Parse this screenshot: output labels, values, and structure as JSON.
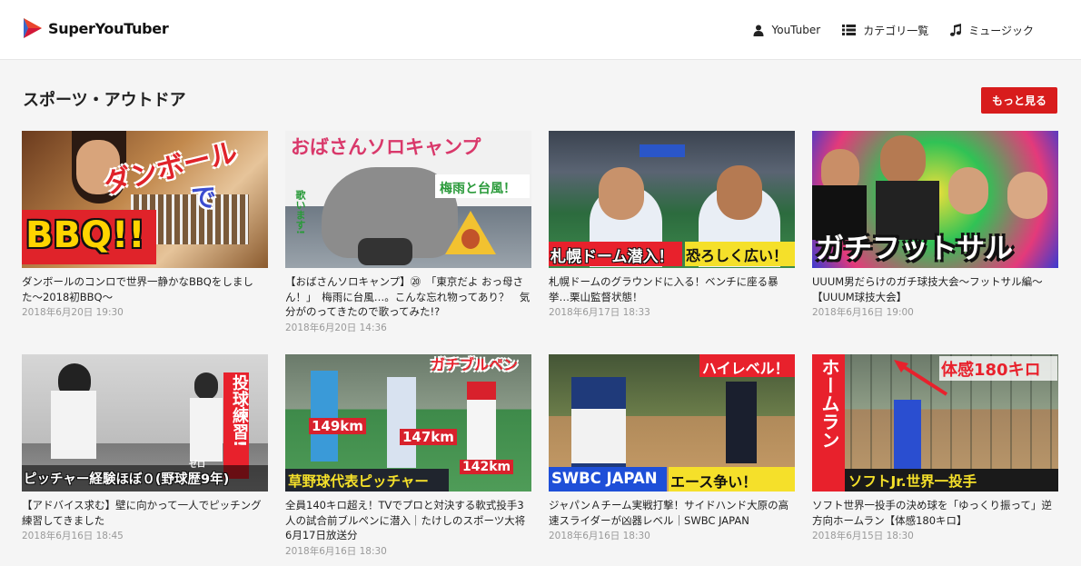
{
  "header": {
    "brand": "SuperYouTuber",
    "nav": [
      {
        "label": "YouTuber",
        "icon": "person-icon"
      },
      {
        "label": "カテゴリ一覧",
        "icon": "list-icon"
      },
      {
        "label": "ミュージック",
        "icon": "music-note-icon"
      }
    ]
  },
  "section": {
    "title": "スポーツ・アウトドア",
    "more_label": "もっと見る"
  },
  "videos": [
    {
      "title": "ダンボールのコンロで世界一静かなBBQをしました〜2018初BBQ〜",
      "date": "2018年6月20日 19:30",
      "caption_a": "ダンボール",
      "caption_b": "で",
      "caption_c": "BBQ!!"
    },
    {
      "title": "【おばさんソロキャンプ】⑳　「東京だよ おっ母さん！」　梅雨に台風…。こんな忘れ物ってあり？　気分がのってきたので歌ってみた!?",
      "date": "2018年6月20日 14:36",
      "caption_a": "おばさんソロキャンプ",
      "caption_b": "梅雨と台風！",
      "caption_c": "歌います!"
    },
    {
      "title": "札幌ドームのグラウンドに入る！ベンチに座る暴挙…栗山監督状態！",
      "date": "2018年6月17日 18:33",
      "caption_a": "札幌ドーム潜入！",
      "caption_b": "恐ろしく広い！"
    },
    {
      "title": "UUUM男だらけのガチ球技大会〜フットサル編〜【UUUM球技大会】",
      "date": "2018年6月16日 19:00",
      "caption_a": "ガチフットサル"
    },
    {
      "title": "【アドバイス求む】壁に向かって一人でピッチング練習してきました",
      "date": "2018年6月16日 18:45",
      "caption_a": "投球練習!",
      "caption_b": "ピッチャー経験ほぼ０(野球歴9年)",
      "caption_c": "ゼロ"
    },
    {
      "title": "全員140キロ超え！TVでプロと対決する軟式投手3人の試合前ブルペンに潜入｜たけしのスポーツ大将6月17日放送分",
      "date": "2018年6月16日 18:30",
      "caption_a": "ガチブルペン",
      "caption_b": "草野球代表ピッチャー",
      "caption_c": "149km",
      "caption_d": "147km",
      "caption_e": "142km"
    },
    {
      "title": "ジャパンＡチーム実戦打撃！サイドハンド大原の高速スライダーが凶器レベル｜SWBC JAPAN",
      "date": "2018年6月16日 18:30",
      "caption_a": "ハイレベル！",
      "caption_b": "SWBC JAPAN",
      "caption_c": "エース争い！"
    },
    {
      "title": "ソフト世界一投手の決め球を「ゆっくり振って」逆方向ホームラン【体感180キロ】",
      "date": "2018年6月15日 18:30",
      "caption_a": "体感180キロ",
      "caption_b": "ホームラン",
      "caption_c": "ソフトJr.世界一投手"
    }
  ]
}
